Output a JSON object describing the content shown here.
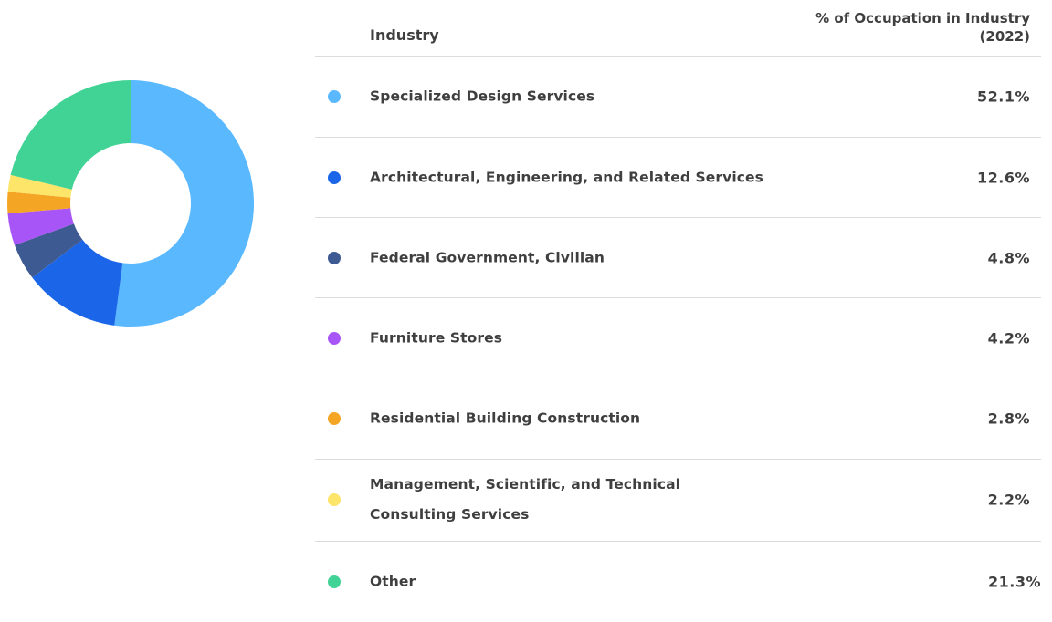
{
  "table": {
    "header_industry": "Industry",
    "header_pct_line1": "% of Occupation in Industry",
    "header_pct_line2": "(2022)"
  },
  "rows": [
    {
      "label": "Specialized Design Services",
      "value": "52.1%",
      "color": "#5ab8ff"
    },
    {
      "label": "Architectural, Engineering, and Related Services",
      "value": "12.6%",
      "color": "#1b66e8"
    },
    {
      "label": "Federal Government, Civilian",
      "value": "4.8%",
      "color": "#3e5a92"
    },
    {
      "label": "Furniture Stores",
      "value": "4.2%",
      "color": "#a855f7"
    },
    {
      "label": "Residential Building Construction",
      "value": "2.8%",
      "color": "#f5a524"
    },
    {
      "label": "Management, Scientific, and Technical Consulting Services",
      "value": "2.2%",
      "color": "#fce568"
    },
    {
      "label": "Other",
      "value": "21.3%",
      "color": "#41d395"
    }
  ],
  "chart_data": {
    "type": "pie",
    "style": "donut",
    "categories": [
      "Specialized Design Services",
      "Architectural, Engineering, and Related Services",
      "Federal Government, Civilian",
      "Furniture Stores",
      "Residential Building Construction",
      "Management, Scientific, and Technical Consulting Services",
      "Other"
    ],
    "values": [
      52.1,
      12.6,
      4.8,
      4.2,
      2.8,
      2.2,
      21.3
    ],
    "colors": [
      "#5ab8ff",
      "#1b66e8",
      "#3e5a92",
      "#a855f7",
      "#f5a524",
      "#fce568",
      "#41d395"
    ],
    "title": "",
    "legend": "right (table)"
  }
}
